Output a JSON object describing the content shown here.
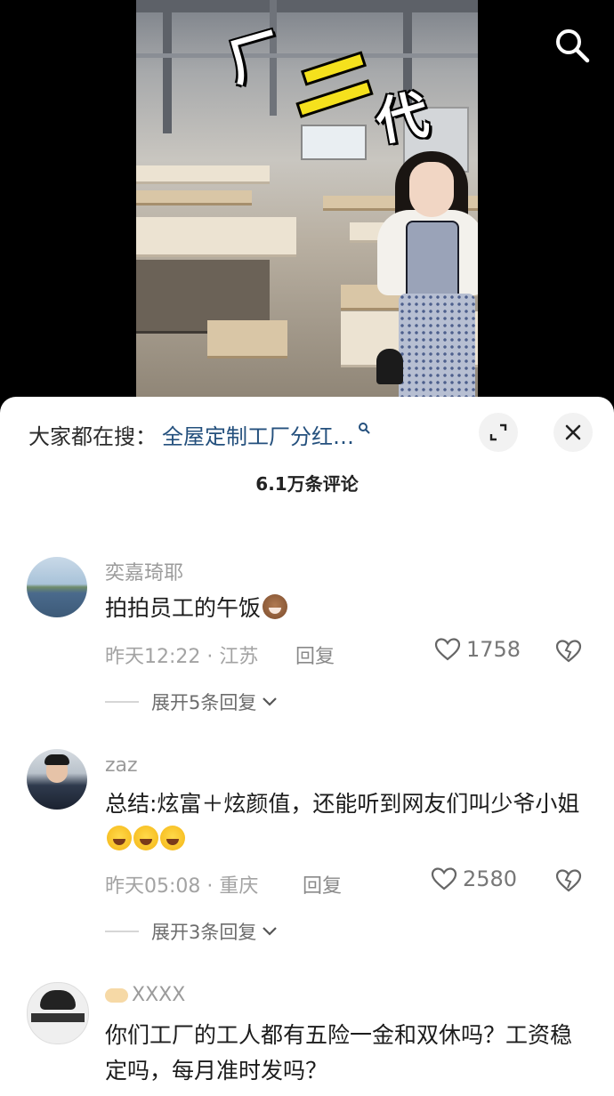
{
  "video": {
    "overlay_text": [
      "厂",
      "二",
      "代"
    ],
    "search_icon": "search-icon"
  },
  "sheet": {
    "search_prefix": "大家都在搜：",
    "search_keyword": "全屋定制工厂分红…",
    "comment_count": "6.1万条评论",
    "expand_icon": "expand-icon",
    "close_icon": "close-icon"
  },
  "comments": [
    {
      "username": "奕嘉琦耶",
      "text": "拍拍员工的午饭",
      "emoji": "pout",
      "meta": "昨天12:22 · 江苏",
      "reply_label": "回复",
      "likes": "1758",
      "expand_label": "展开5条回复"
    },
    {
      "username": "zaz",
      "text": "总结:炫富＋炫颜值，还能听到网友们叫少爷小姐",
      "emoji": "joy x3",
      "meta": "昨天05:08 · 重庆",
      "reply_label": "回复",
      "likes": "2580",
      "expand_label": "展开3条回复"
    },
    {
      "username": "XXXX",
      "text": "你们工厂的工人都有五险一金和双休吗？工资稳定吗，每月准时发吗？"
    }
  ],
  "colors": {
    "keyword": "#24507d",
    "muted": "#a3a3a3",
    "sheet_bg": "#ffffff"
  }
}
